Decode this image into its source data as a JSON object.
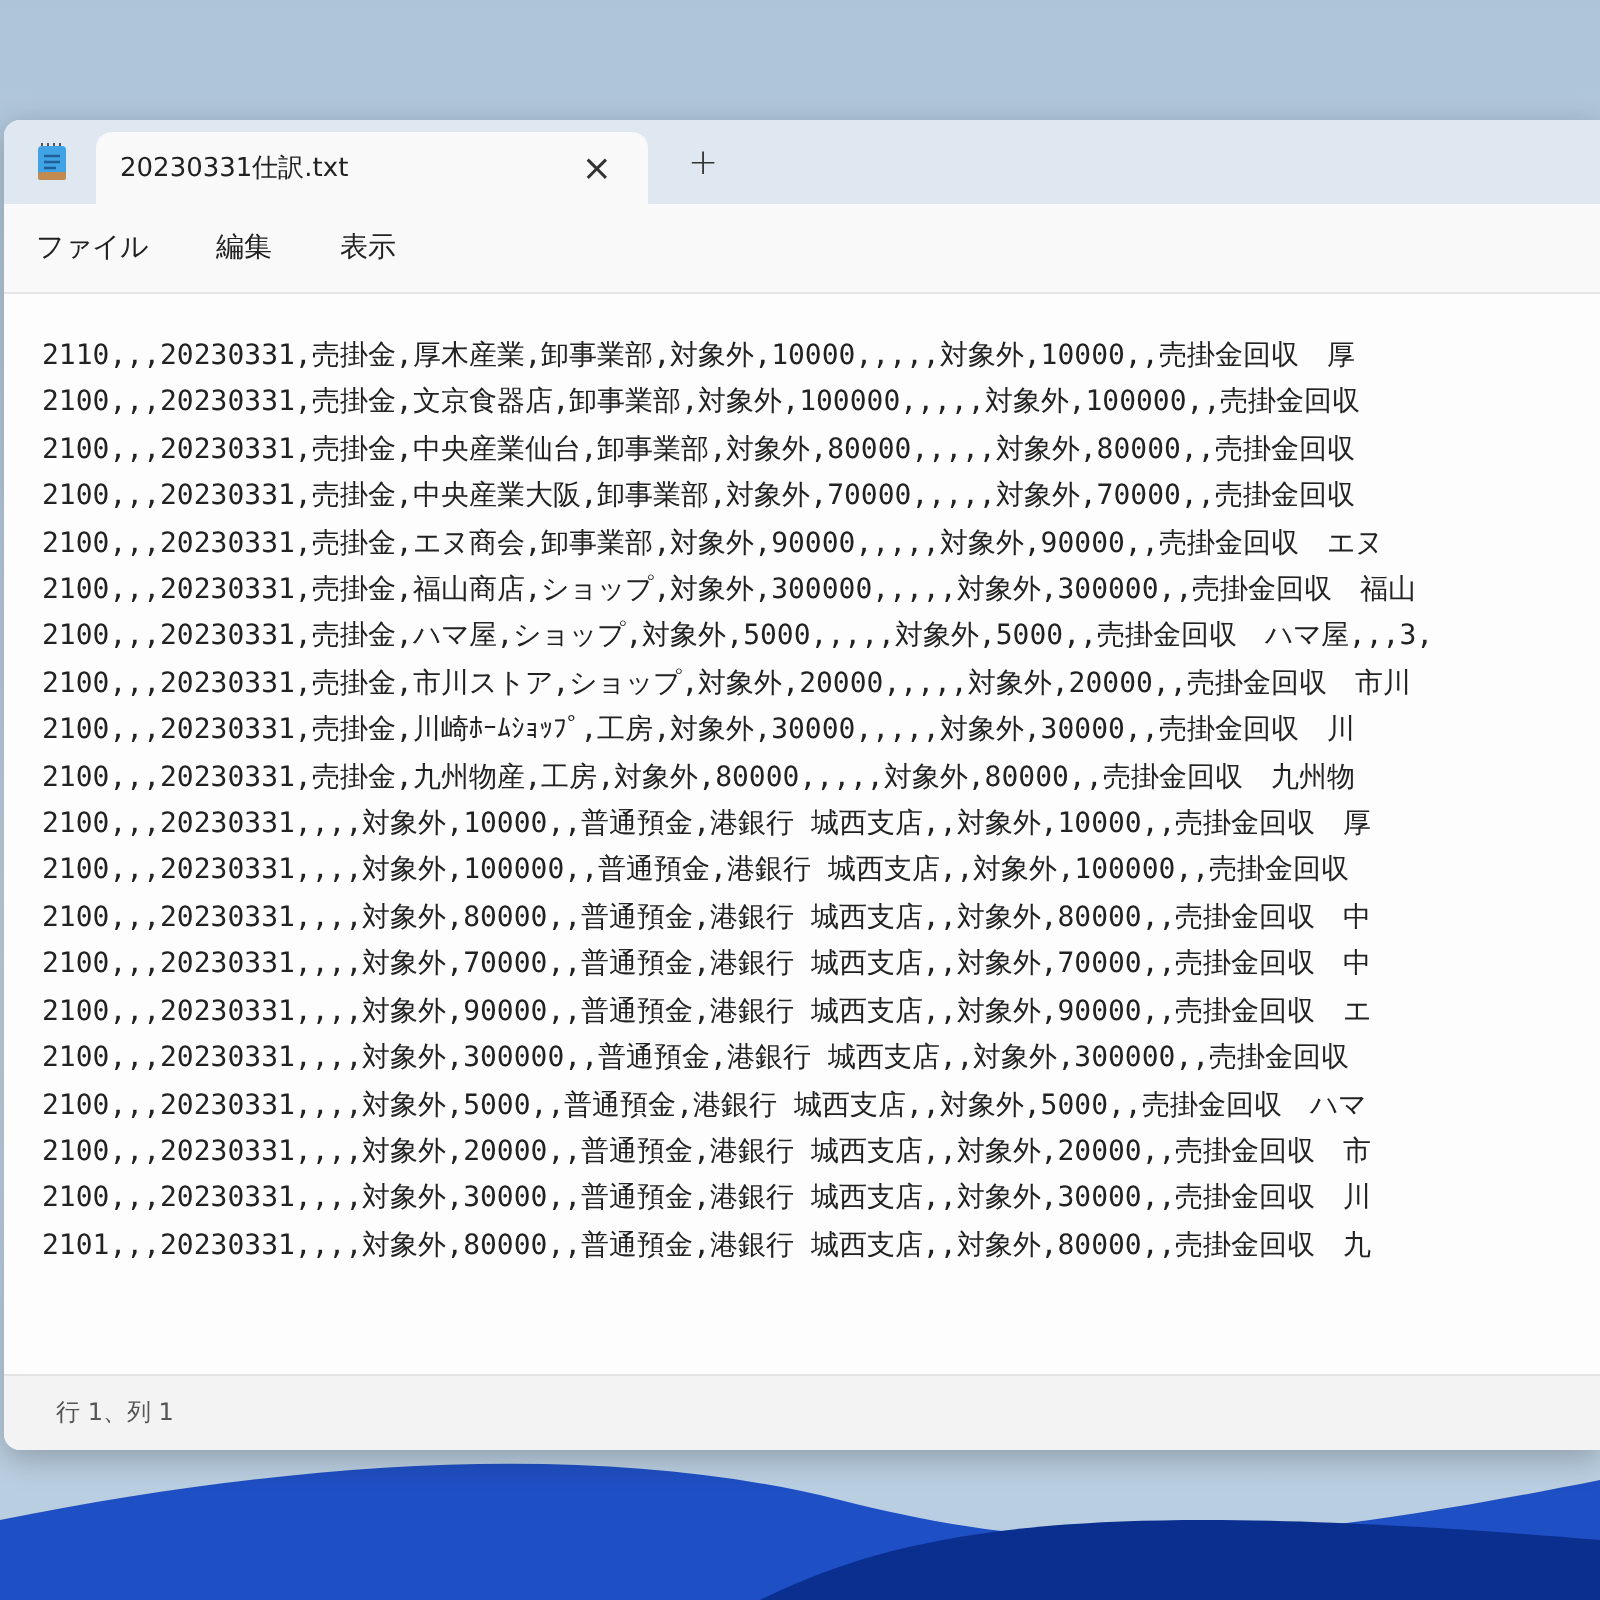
{
  "tab": {
    "title": "20230331仕訳.txt",
    "close": "×",
    "new_tab": "+"
  },
  "menu": [
    "ファイル",
    "編集",
    "表示"
  ],
  "lines": [
    "2110,,,20230331,売掛金,厚木産業,卸事業部,対象外,10000,,,,,対象外,10000,,売掛金回収　厚",
    "2100,,,20230331,売掛金,文京食器店,卸事業部,対象外,100000,,,,,対象外,100000,,売掛金回収",
    "2100,,,20230331,売掛金,中央産業仙台,卸事業部,対象外,80000,,,,,対象外,80000,,売掛金回収",
    "2100,,,20230331,売掛金,中央産業大阪,卸事業部,対象外,70000,,,,,対象外,70000,,売掛金回収",
    "2100,,,20230331,売掛金,エヌ商会,卸事業部,対象外,90000,,,,,対象外,90000,,売掛金回収　エヌ",
    "2100,,,20230331,売掛金,福山商店,ショップ,対象外,300000,,,,,対象外,300000,,売掛金回収　福山",
    "2100,,,20230331,売掛金,ハマ屋,ショップ,対象外,5000,,,,,対象外,5000,,売掛金回収　ハマ屋,,,3,",
    "2100,,,20230331,売掛金,市川ストア,ショップ,対象外,20000,,,,,対象外,20000,,売掛金回収　市川",
    "2100,,,20230331,売掛金,川崎ﾎｰﾑｼｮｯﾌﾟ,工房,対象外,30000,,,,,対象外,30000,,売掛金回収　川",
    "2100,,,20230331,売掛金,九州物産,工房,対象外,80000,,,,,対象外,80000,,売掛金回収　九州物",
    "2100,,,20230331,,,,対象外,10000,,普通預金,港銀行 城西支店,,対象外,10000,,売掛金回収　厚",
    "2100,,,20230331,,,,対象外,100000,,普通預金,港銀行 城西支店,,対象外,100000,,売掛金回収",
    "2100,,,20230331,,,,対象外,80000,,普通預金,港銀行 城西支店,,対象外,80000,,売掛金回収　中",
    "2100,,,20230331,,,,対象外,70000,,普通預金,港銀行 城西支店,,対象外,70000,,売掛金回収　中",
    "2100,,,20230331,,,,対象外,90000,,普通預金,港銀行 城西支店,,対象外,90000,,売掛金回収　エ",
    "2100,,,20230331,,,,対象外,300000,,普通預金,港銀行 城西支店,,対象外,300000,,売掛金回収",
    "2100,,,20230331,,,,対象外,5000,,普通預金,港銀行 城西支店,,対象外,5000,,売掛金回収　ハマ",
    "2100,,,20230331,,,,対象外,20000,,普通預金,港銀行 城西支店,,対象外,20000,,売掛金回収　市",
    "2100,,,20230331,,,,対象外,30000,,普通預金,港銀行 城西支店,,対象外,30000,,売掛金回収　川",
    "2101,,,20230331,,,,対象外,80000,,普通預金,港銀行 城西支店,,対象外,80000,,売掛金回収　九"
  ],
  "status_bar": "行 1、列 1"
}
